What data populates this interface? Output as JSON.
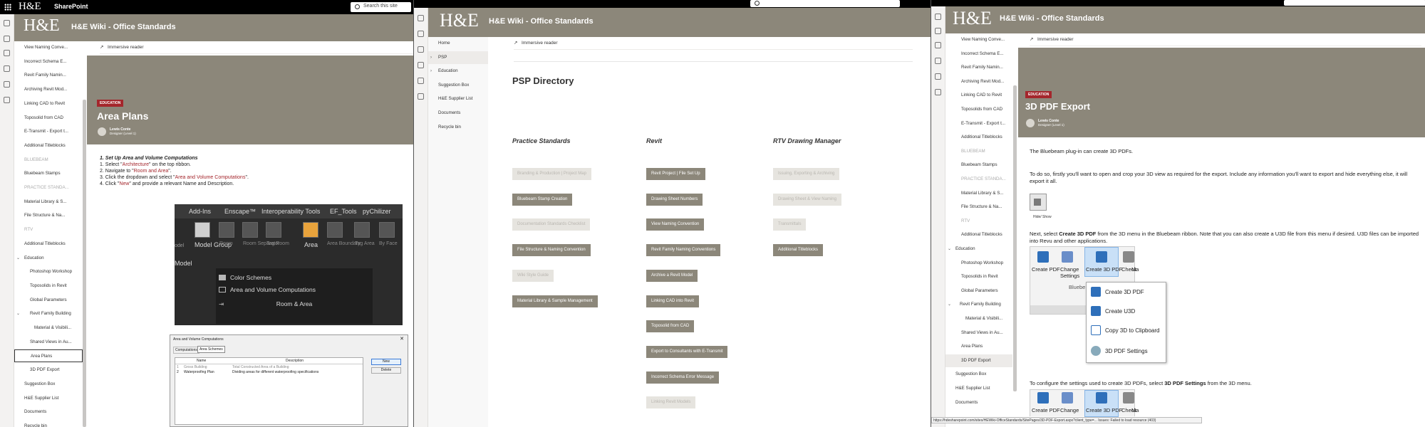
{
  "top": {
    "logo": "H&E",
    "app": "SharePoint",
    "search_placeholder": "Search this site"
  },
  "site": {
    "logo": "H&E",
    "title": "H&E Wiki - Office Standards"
  },
  "cmd": {
    "immersive": "Immersive reader"
  },
  "panel1": {
    "nav": [
      "View Naming Conve...",
      "Incorrect Schema E...",
      "Revit Family Namin...",
      "Archiving Revit Mod...",
      "Linking CAD to Revit",
      "Toposolid from CAD",
      "E-Transmit - Export t...",
      "Additional Titleblocks",
      "BLUEBEAM",
      "Bluebeam Stamps",
      "PRACTICE STANDA...",
      "Material Library & S...",
      "File Structure & Na...",
      "RTV",
      "Additional Titleblocks",
      "Education",
      "Photoshop Workshop",
      "Toposolids in Revit",
      "Global Parameters",
      "Revit Family Building",
      "Material & Visibili...",
      "Shared Views in Au...",
      "Area Plans",
      "3D PDF Export",
      "Suggestion Box",
      "H&E Supplier List",
      "Documents",
      "Recycle bin"
    ],
    "hero": {
      "badge": "EDUCATION",
      "title": "Area Plans",
      "author": "Lewis Conte",
      "role": "Designer (Level 1)"
    },
    "steps": {
      "heading": "1. Set Up Area and Volume Computations",
      "s1a": "1. Select \"",
      "s1b": "Architecture",
      "s1c": "\" on the top ribbon.",
      "s2a": "2. Navigate to \"",
      "s2b": "Room and Area",
      "s2c": "\".",
      "s3a": "3. Click the dropdown and select \"",
      "s3b": "Area and Volume Computations",
      "s3c": "\".",
      "s4a": "4. Click \"",
      "s4b": "New",
      "s4c": "\" and provide a relevant Name and Description."
    },
    "revit": {
      "menu": [
        "Add-Ins",
        "Enscape™",
        "Interoperability Tools",
        "EF_Tools",
        "pyChilizer"
      ],
      "tools": [
        "Model Group",
        "Room",
        "Room Separator",
        "Tag Room",
        "Area",
        "Area Boundary",
        "Tag Area",
        "By Face"
      ],
      "left": [
        "odel",
        "Model"
      ],
      "dropdown": [
        "Color Schemes",
        "Area and Volume Computations",
        "Room & Area"
      ]
    },
    "dialog": {
      "title": "Area and Volume Computations",
      "tabs": [
        "Computations",
        "Area Schemes"
      ],
      "cols": [
        "Name",
        "Description"
      ],
      "rows": [
        {
          "n": "1",
          "name": "Gross Building",
          "desc": "Total Constructed Area of a Building"
        },
        {
          "n": "2",
          "name": "Waterproofing Plan",
          "desc": "Dividing areas for different waterproofing specifications"
        }
      ],
      "buttons": [
        "New",
        "Delete"
      ]
    }
  },
  "panel2": {
    "nav": [
      "Home",
      "PSP",
      "Education",
      "Suggestion Box",
      "H&E Supplier List",
      "Documents",
      "Recycle bin"
    ],
    "title": "PSP Directory",
    "columns": [
      {
        "title": "Practice Standards",
        "items": [
          {
            "label": "Branding & Production | Project Map",
            "on": false
          },
          {
            "label": "Bluebeam Stamp Creation",
            "on": true
          },
          {
            "label": "Documentation Standards Checklist",
            "on": false
          },
          {
            "label": "File Structure & Naming Convention",
            "on": true
          },
          {
            "label": "Wiki Style Guide",
            "on": false
          },
          {
            "label": "Material Library & Sample Management",
            "on": true
          }
        ]
      },
      {
        "title": "Revit",
        "items": [
          {
            "label": "Revit Project | File Set Up",
            "on": true
          },
          {
            "label": "Drawing Sheet Numbers",
            "on": true
          },
          {
            "label": "View Naming Convention",
            "on": true
          },
          {
            "label": "Revit Family Naming Conventions",
            "on": true
          },
          {
            "label": "Archive a Revit Model",
            "on": true
          },
          {
            "label": "Linking CAD into Revit",
            "on": true
          },
          {
            "label": "Toposolid from CAD",
            "on": true
          },
          {
            "label": "Export to Consultants with E-Transmit",
            "on": true
          },
          {
            "label": "Incorrect Schema Error Message",
            "on": true
          },
          {
            "label": "Linking Revit Models",
            "on": false
          }
        ]
      },
      {
        "title": "RTV Drawing Manager",
        "items": [
          {
            "label": "Issuing, Exporting & Archiving",
            "on": false
          },
          {
            "label": "Drawing Sheet & View Naming",
            "on": false
          },
          {
            "label": "Transmittals",
            "on": false
          },
          {
            "label": "Additional Titleblocks",
            "on": true
          }
        ]
      }
    ]
  },
  "panel3": {
    "nav": [
      "View Naming Conve...",
      "Incorrect Schema E...",
      "Revit Family Namin...",
      "Archiving Revit Mod...",
      "Linking CAD to Revit",
      "Toposolids from CAD",
      "E-Transmit - Export t...",
      "Additional Titleblocks",
      "BLUEBEAM",
      "Bluebeam Stamps",
      "PRACTICE STANDA...",
      "Material Library & S...",
      "File Structure & Na...",
      "RTV",
      "Additional Titleblocks",
      "Education",
      "Photoshop Workshop",
      "Toposolids in Revit",
      "Global Parameters",
      "Revit Family Building",
      "Material & Visibili...",
      "Shared Views in Au...",
      "Area Plans",
      "3D PDF Export",
      "Suggestion Box",
      "H&E Supplier List",
      "Documents"
    ],
    "hero": {
      "badge": "EDUCATION",
      "title": "3D PDF Export",
      "author": "Lewis Conte",
      "role": "Designer (Level 1)"
    },
    "p1": "The Bluebeam plug-in can create 3D PDFs.",
    "p2": "To do so, firstly you'll want to open and crop your 3D view as required for the export. Include any information you'll want to export and hide everything else, it will export it all.",
    "iconcap": "Hide/ Show",
    "p3a": "Next, select ",
    "p3b": "Create 3D PDF",
    "p3c": " from the 3D menu in the Bluebeam ribbon. Note that you can also create a U3D file from this menu if desired. U3D files can be imported into Revu and other applications.",
    "ribbon": {
      "btns": [
        "Create PDF",
        "Change Settings",
        "Create 3D PDF",
        "Check",
        "Ma"
      ],
      "group": "Bluebe"
    },
    "menu": [
      "Create 3D PDF",
      "Create U3D",
      "Copy 3D to Clipboard",
      "3D PDF Settings"
    ],
    "p4a": "To configure the settings used to create 3D PDFs, select ",
    "p4b": "3D PDF Settings",
    "p4c": " from the 3D menu.",
    "ribbon2": [
      "Create PDF",
      "Change",
      "Create 3D PDF",
      "Check",
      "Ma"
    ],
    "status": "https://hdesharepoint.com/sites/HEWiki-OfficeStandards/SitePages/3D-PDF-Export.aspx?client_type=...  Issues: Failed to load resource (403)"
  }
}
